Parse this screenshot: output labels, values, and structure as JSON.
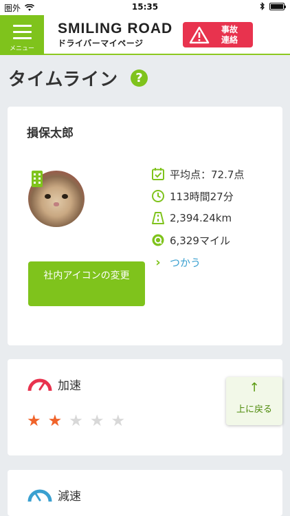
{
  "status_bar": {
    "carrier": "圏外",
    "time": "15:35"
  },
  "header": {
    "menu_label": "メニュー",
    "logo_main": "SMILING ROAD",
    "logo_sub": "ドライバーマイページ",
    "accident_line1": "事故",
    "accident_line2": "連絡"
  },
  "page": {
    "title": "タイムライン",
    "help": "?"
  },
  "profile": {
    "name": "損保太郎",
    "avg_score": "平均点：72.7点",
    "drive_time": "113時間27分",
    "distance": "2,394.24km",
    "miles": "6,329マイル",
    "use_link": "つかう",
    "change_icon_button": "社内アイコンの変更"
  },
  "acceleration": {
    "title": "加速",
    "rating": 2,
    "max_rating": 5
  },
  "deceleration": {
    "title": "減速"
  },
  "back_to_top": {
    "arrow": "↑",
    "label": "上に戻る"
  },
  "colors": {
    "brand_green": "#7fc31c",
    "accident_red": "#e8334e",
    "link_blue": "#3aa0d0",
    "star_on": "#f0632a",
    "star_off": "#d8d8d8"
  }
}
